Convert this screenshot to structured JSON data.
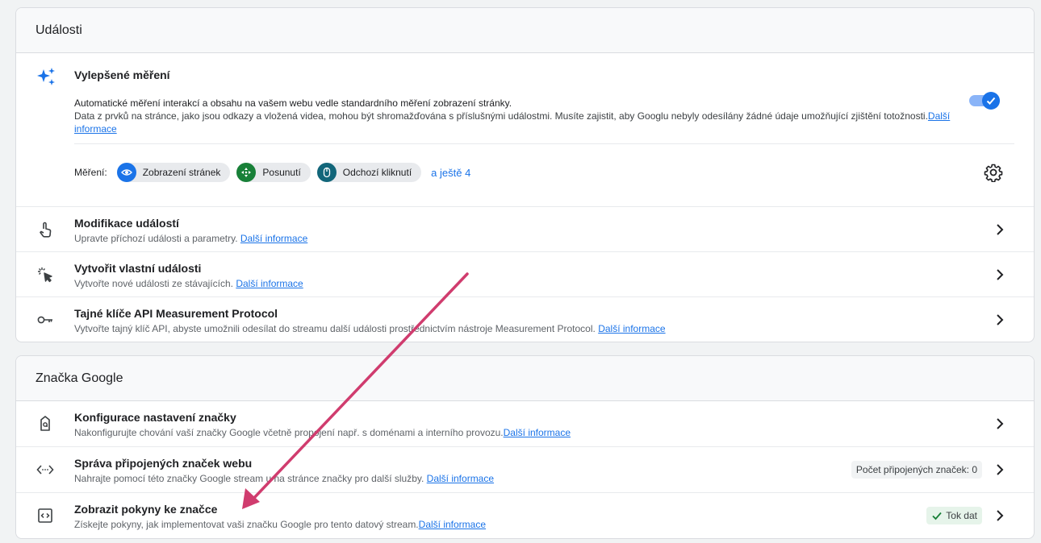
{
  "events_card": {
    "title": "Události",
    "enhanced": {
      "title": "Vylepšené měření",
      "desc_strong": "Automatické měření interakcí a obsahu na vašem webu vedle standardního měření zobrazení stránky.",
      "desc_body": "Data z prvků na stránce, jako jsou odkazy a vložená videa, mohou být shromažďována s příslušnými událostmi. Musíte zajistit, aby Googlu nebyly odesílány žádné údaje umožňující zjištění totožnosti.",
      "learn_more": "Další informace",
      "toggle_on": true,
      "measurement_label": "Měření:",
      "chips": [
        {
          "label": "Zobrazení stránek",
          "icon": "eye-icon",
          "color": "#1a73e8"
        },
        {
          "label": "Posunutí",
          "icon": "scroll-arrows-icon",
          "color": "#188038"
        },
        {
          "label": "Odchozí kliknutí",
          "icon": "mouse-icon",
          "color": "#12667a"
        }
      ],
      "more": "a ještě 4"
    },
    "rows": [
      {
        "title": "Modifikace událostí",
        "desc": "Upravte příchozí události a parametry.",
        "link": "Další informace",
        "icon": "touch-hand-icon"
      },
      {
        "title": "Vytvořit vlastní události",
        "desc": "Vytvořte nové události ze stávajících.",
        "link": "Další informace",
        "icon": "cursor-click-icon"
      },
      {
        "title": "Tajné klíče API Measurement Protocol",
        "desc": "Vytvořte tajný klíč API, abyste umožnili odesílat do streamu další události prostřednictvím nástroje Measurement Protocol.",
        "link": "Další informace",
        "icon": "key-icon"
      }
    ]
  },
  "tag_card": {
    "title": "Značka Google",
    "rows": [
      {
        "title": "Konfigurace nastavení značky",
        "desc": "Nakonfigurujte chování vaší značky Google včetně propojení např. s doménami a interního provozu.",
        "link": "Další informace",
        "icon": "tag-icon"
      },
      {
        "title": "Správa připojených značek webu",
        "desc": "Nahrajte pomocí této značky Google stream u na stránce značky pro další služby.",
        "link": "Další informace",
        "icon": "code-arrows-icon",
        "badge": "Počet připojených značek: 0"
      },
      {
        "title": "Zobrazit pokyny ke značce",
        "desc": "Získejte pokyny, jak implementovat vaši značku Google pro tento datový stream.",
        "link": "Další informace",
        "icon": "code-doc-icon",
        "badge": "Tok dat"
      }
    ]
  },
  "colors": {
    "accent": "#1a73e8",
    "annotation_arrow": "#d03c6e",
    "success_bg": "#e6f4ea",
    "success_check": "#188038"
  }
}
